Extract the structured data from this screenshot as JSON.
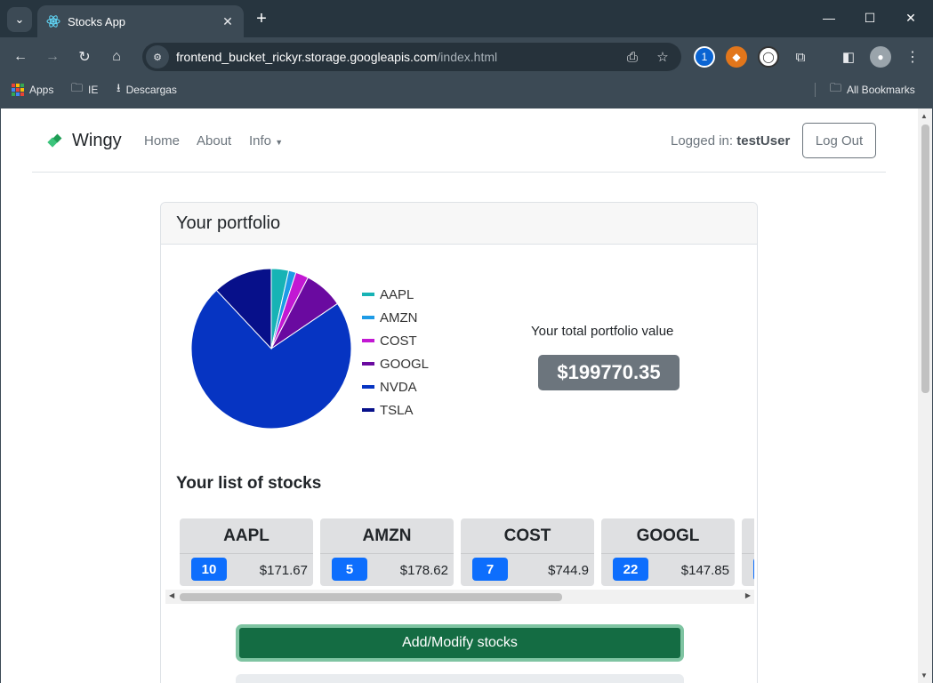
{
  "browser": {
    "tab_title": "Stocks App",
    "url_host": "frontend_bucket_rickyr.storage.googleapis.com",
    "url_path": "/index.html",
    "bookmarks": [
      "Apps",
      "IE",
      "Descargas"
    ],
    "all_bookmarks": "All Bookmarks"
  },
  "navbar": {
    "brand": "Wingy",
    "links": [
      "Home",
      "About",
      "Info"
    ],
    "logged_in_label": "Logged in:",
    "username": "testUser",
    "logout": "Log Out"
  },
  "portfolio": {
    "header": "Your portfolio",
    "total_label": "Your total portfolio value",
    "total_value": "$199770.35",
    "list_title": "Your list of stocks",
    "add_button": "Add/Modify stocks"
  },
  "chart_data": {
    "type": "pie",
    "categories": [
      "AAPL",
      "AMZN",
      "COST",
      "GOOGL",
      "NVDA",
      "TSLA"
    ],
    "values": [
      3.5,
      1.5,
      2.6,
      7.9,
      72.5,
      12.0
    ],
    "colors": [
      "#17b3b5",
      "#1e9be6",
      "#c218d3",
      "#6a0aa0",
      "#0634c2",
      "#07108a"
    ],
    "legend_position": "right"
  },
  "stocks": [
    {
      "symbol": "AAPL",
      "quantity": "10",
      "price": "$171.67"
    },
    {
      "symbol": "AMZN",
      "quantity": "5",
      "price": "$178.62"
    },
    {
      "symbol": "COST",
      "quantity": "7",
      "price": "$744.9"
    },
    {
      "symbol": "GOOGL",
      "quantity": "22",
      "price": "$147.85"
    }
  ]
}
